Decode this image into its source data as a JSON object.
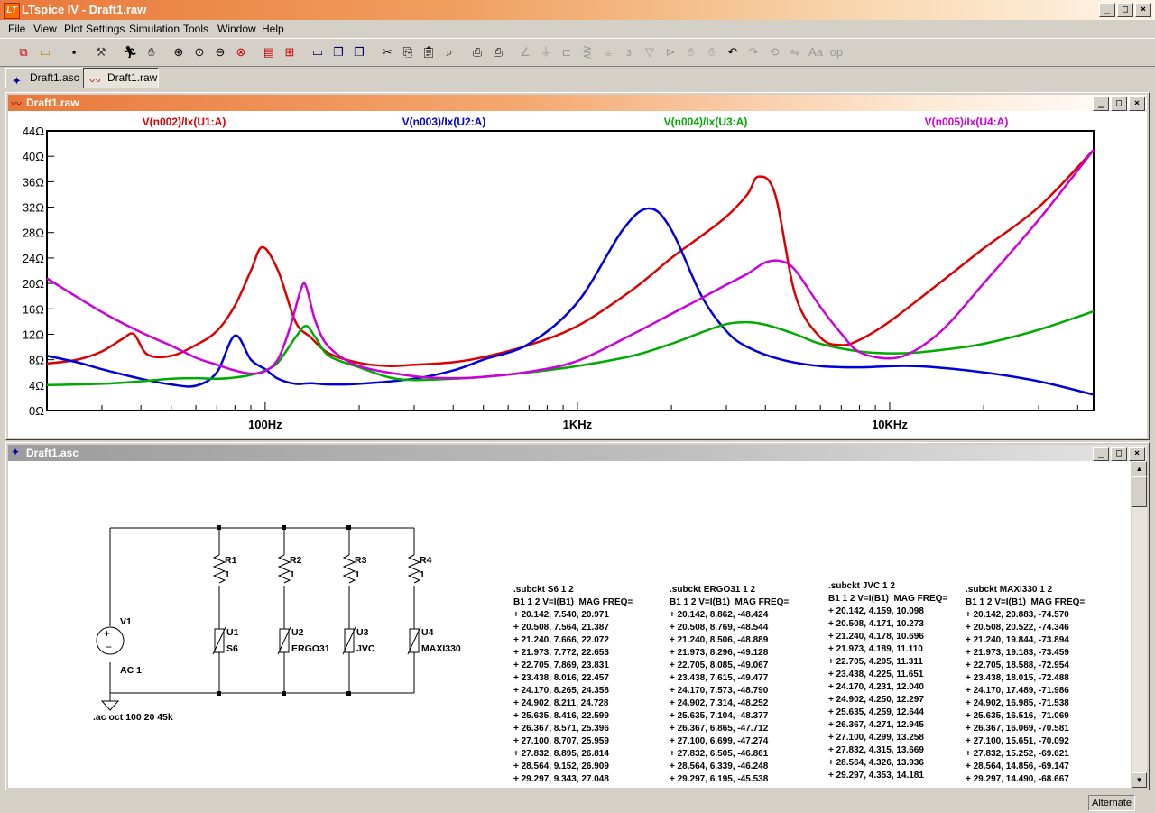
{
  "app": {
    "title": "LTspice IV - Draft1.raw",
    "icon_text": "LT"
  },
  "menu": [
    {
      "label": "File"
    },
    {
      "label": "View"
    },
    {
      "label": "Plot Settings"
    },
    {
      "label": "Simulation"
    },
    {
      "label": "Tools"
    },
    {
      "label": "Window"
    },
    {
      "label": "Help"
    }
  ],
  "tabs": [
    {
      "label": "Draft1.asc"
    },
    {
      "label": "Draft1.raw"
    }
  ],
  "plot_window": {
    "title": "Draft1.raw",
    "traces": [
      {
        "label": "V(n002)/Ix(U1:A)",
        "color": "#dd0000"
      },
      {
        "label": "V(n003)/Ix(U2:A)",
        "color": "#0000dd"
      },
      {
        "label": "V(n004)/Ix(U3:A)",
        "color": "#00aa00"
      },
      {
        "label": "V(n005)/Ix(U4:A)",
        "color": "#cc00dd"
      }
    ]
  },
  "chart_data": {
    "type": "line",
    "xscale": "log",
    "xlim": [
      20,
      45000
    ],
    "ylim": [
      0,
      44
    ],
    "xticks": [
      "100Hz",
      "1KHz",
      "10KHz"
    ],
    "yticks": [
      "0Ω",
      "4Ω",
      "8Ω",
      "12Ω",
      "16Ω",
      "20Ω",
      "24Ω",
      "28Ω",
      "32Ω",
      "36Ω",
      "40Ω",
      "44Ω"
    ],
    "ytick_values": [
      0,
      4,
      8,
      12,
      16,
      20,
      24,
      28,
      32,
      36,
      40,
      44
    ],
    "xtick_values": [
      100,
      1000,
      10000
    ],
    "series": [
      {
        "name": "V(n002)/Ix(U1:A)",
        "color": "#dd0000",
        "x": [
          20,
          25,
          30,
          35,
          38,
          42,
          50,
          60,
          70,
          80,
          90,
          98,
          110,
          125,
          140,
          160,
          200,
          250,
          300,
          400,
          500,
          700,
          1000,
          1500,
          2000,
          2500,
          3000,
          3500,
          3800,
          4300,
          5000,
          6000,
          7000,
          8000,
          10000,
          15000,
          20000,
          30000,
          45000
        ],
        "y": [
          7.4,
          8,
          9.3,
          11.3,
          12,
          8.8,
          8.6,
          10.3,
          12.5,
          16.5,
          22,
          25.7,
          22,
          14,
          11.5,
          9,
          7.5,
          7,
          7.2,
          7.6,
          8.4,
          10.3,
          13.3,
          19,
          24,
          27.5,
          30.5,
          34,
          36.8,
          34,
          18,
          11.5,
          10.3,
          11.1,
          14,
          20.7,
          25.5,
          32,
          41
        ]
      },
      {
        "name": "V(n003)/Ix(U2:A)",
        "color": "#0000dd",
        "x": [
          20,
          25,
          30,
          40,
          50,
          60,
          70,
          80,
          90,
          100,
          110,
          125,
          140,
          160,
          200,
          300,
          400,
          500,
          700,
          1000,
          1400,
          1700,
          2000,
          2500,
          3000,
          3500,
          4500,
          6000,
          8000,
          12000,
          20000,
          30000,
          45000
        ],
        "y": [
          8.6,
          7.6,
          6.5,
          5,
          4.1,
          3.9,
          6,
          11.8,
          8,
          6.5,
          5,
          4.2,
          4.3,
          4.1,
          4.2,
          5,
          6.3,
          8,
          10.5,
          17,
          28.5,
          31.8,
          28.4,
          18,
          12.5,
          10,
          8,
          7,
          6.8,
          7,
          6,
          4.6,
          2.5
        ]
      },
      {
        "name": "V(n004)/Ix(U3:A)",
        "color": "#00aa00",
        "x": [
          20,
          30,
          40,
          50,
          60,
          70,
          80,
          90,
          100,
          110,
          125,
          135,
          145,
          160,
          200,
          250,
          300,
          400,
          500,
          700,
          1000,
          1500,
          2000,
          2500,
          3000,
          3500,
          4000,
          5000,
          6000,
          8000,
          10000,
          12000,
          15000,
          20000,
          30000,
          45000
        ],
        "y": [
          4,
          4.2,
          4.6,
          5,
          5.1,
          5,
          5.2,
          5.6,
          6.3,
          7.6,
          11.5,
          13.3,
          11.5,
          8.6,
          6.8,
          5.2,
          4.8,
          5,
          5.3,
          6,
          7,
          8.6,
          10.5,
          12.3,
          13.6,
          13.9,
          13.5,
          12,
          10.5,
          9.3,
          9,
          9.1,
          9.6,
          10.5,
          12.7,
          15.6
        ]
      },
      {
        "name": "V(n005)/Ix(U4:A)",
        "color": "#cc00dd",
        "x": [
          20,
          30,
          40,
          50,
          60,
          70,
          80,
          90,
          100,
          110,
          120,
          130,
          135,
          145,
          160,
          200,
          300,
          400,
          500,
          700,
          1000,
          1500,
          2000,
          2500,
          3000,
          3500,
          4000,
          4500,
          5000,
          6000,
          7000,
          8000,
          10000,
          12000,
          15000,
          20000,
          30000,
          45000
        ],
        "y": [
          20.8,
          15.5,
          12.3,
          10.2,
          8.3,
          7.2,
          6.3,
          5.8,
          6.2,
          8.1,
          13,
          19,
          19.6,
          14,
          10,
          7,
          5.4,
          5.1,
          5.3,
          6.1,
          7.8,
          12,
          15.2,
          17.7,
          19.8,
          21.5,
          23.3,
          23.5,
          22,
          16.3,
          12.1,
          9.2,
          8.2,
          9.4,
          13,
          20,
          30,
          41
        ]
      }
    ]
  },
  "schematic_window": {
    "title": "Draft1.asc"
  },
  "schematic": {
    "resistors": [
      {
        "name": "R1",
        "value": "1"
      },
      {
        "name": "R2",
        "value": "1"
      },
      {
        "name": "R3",
        "value": "1"
      },
      {
        "name": "R4",
        "value": "1"
      }
    ],
    "subckts": [
      {
        "name": "U1",
        "model": "S6"
      },
      {
        "name": "U2",
        "model": "ERGO31"
      },
      {
        "name": "U3",
        "model": "JVC"
      },
      {
        "name": "U4",
        "model": "MAXI330"
      }
    ],
    "source": {
      "name": "V1",
      "value": "AC 1"
    },
    "directive": ".ac oct 100 20 45k"
  },
  "netlists": [
    {
      "text": ".subckt S6 1 2\nB1 1 2 V=I(B1)  MAG FREQ=\n+ 20.142, 7.540, 20.971\n+ 20.508, 7.564, 21.387\n+ 21.240, 7.666, 22.072\n+ 21.973, 7.772, 22.653\n+ 22.705, 7.869, 23.831\n+ 23.438, 8.016, 22.457\n+ 24.170, 8.265, 24.358\n+ 24.902, 8.211, 24.728\n+ 25.635, 8.416, 22.599\n+ 26.367, 8.571, 25.396\n+ 27.100, 8.707, 25.959\n+ 27.832, 8.895, 26.814\n+ 28.564, 9.152, 26.909\n+ 29.297, 9.343, 27.048"
    },
    {
      "text": ".subckt ERGO31 1 2\nB1 1 2 V=I(B1)  MAG FREQ=\n+ 20.142, 8.862, -48.424\n+ 20.508, 8.769, -48.544\n+ 21.240, 8.506, -48.889\n+ 21.973, 8.296, -49.128\n+ 22.705, 8.085, -49.067\n+ 23.438, 7.615, -49.477\n+ 24.170, 7.573, -48.790\n+ 24.902, 7.314, -48.252\n+ 25.635, 7.104, -48.377\n+ 26.367, 6.865, -47.712\n+ 27.100, 6.699, -47.274\n+ 27.832, 6.505, -46.861\n+ 28.564, 6.339, -46.248\n+ 29.297, 6.195, -45.538"
    },
    {
      "text": ".subckt JVC 1 2\nB1 1 2 V=I(B1)  MAG FREQ=\n+ 20.142, 4.159, 10.098\n+ 20.508, 4.171, 10.273\n+ 21.240, 4.178, 10.696\n+ 21.973, 4.189, 11.110\n+ 22.705, 4.205, 11.311\n+ 23.438, 4.225, 11.651\n+ 24.170, 4.231, 12.040\n+ 24.902, 4.250, 12.297\n+ 25.635, 4.259, 12.644\n+ 26.367, 4.271, 12.945\n+ 27.100, 4.299, 13.258\n+ 27.832, 4.315, 13.669\n+ 28.564, 4.326, 13.936\n+ 29.297, 4.353, 14.181"
    },
    {
      "text": ".subckt MAXI330 1 2\nB1 1 2 V=I(B1)  MAG FREQ=\n+ 20.142, 20.883, -74.570\n+ 20.508, 20.522, -74.346\n+ 21.240, 19.844, -73.894\n+ 21.973, 19.183, -73.459\n+ 22.705, 18.588, -72.954\n+ 23.438, 18.015, -72.488\n+ 24.170, 17.489, -71.986\n+ 24.902, 16.985, -71.538\n+ 25.635, 16.516, -71.069\n+ 26.367, 16.069, -70.581\n+ 27.100, 15.651, -70.092\n+ 27.832, 15.252, -69.621\n+ 28.564, 14.856, -69.147\n+ 29.297, 14.490, -68.667"
    }
  ],
  "status": {
    "mode": "Alternate"
  }
}
